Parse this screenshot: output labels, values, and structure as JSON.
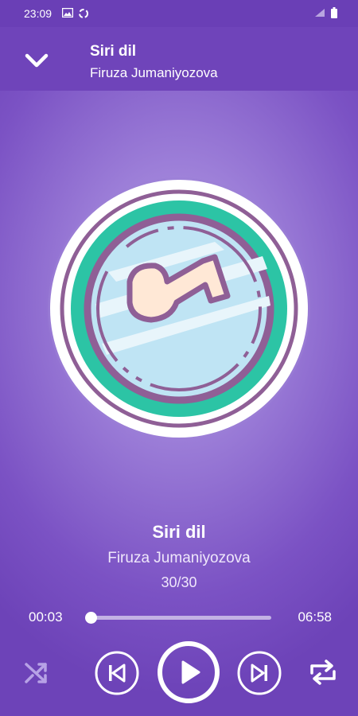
{
  "status": {
    "time": "23:09"
  },
  "header": {
    "title": "Siri dil",
    "artist": "Firuza Jumaniyozova"
  },
  "track": {
    "title": "Siri dil",
    "artist": "Firuza Jumaniyozova",
    "position": "30/30"
  },
  "progress": {
    "current": "00:03",
    "total": "06:58",
    "fraction": 0.007
  },
  "icons": {
    "back": "chevron-down-icon",
    "shuffle": "shuffle-icon",
    "previous": "skip-previous-icon",
    "play": "play-icon",
    "next": "skip-next-icon",
    "repeat": "repeat-icon"
  },
  "colors": {
    "status_bar": "#6a3fb6",
    "header": "#6f44ba",
    "accent_teal": "#2cc4a5",
    "seek_track": "#c3b2e4"
  }
}
